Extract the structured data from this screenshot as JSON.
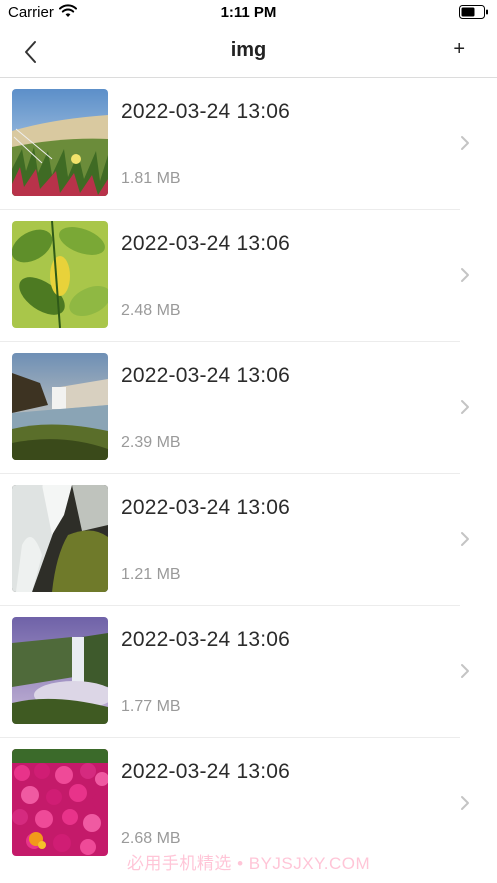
{
  "status_bar": {
    "carrier": "Carrier",
    "time": "1:11 PM"
  },
  "nav": {
    "title": "img",
    "add_label": "+"
  },
  "files": [
    {
      "date": "2022-03-24 13:06",
      "size": "1.81 MB",
      "thumbnail": "dune-flowers"
    },
    {
      "date": "2022-03-24 13:06",
      "size": "2.48 MB",
      "thumbnail": "green-leaves"
    },
    {
      "date": "2022-03-24 13:06",
      "size": "2.39 MB",
      "thumbnail": "waterfall-cliff"
    },
    {
      "date": "2022-03-24 13:06",
      "size": "1.21 MB",
      "thumbnail": "waterfall-mossy"
    },
    {
      "date": "2022-03-24 13:06",
      "size": "1.77 MB",
      "thumbnail": "waterfall-mist"
    },
    {
      "date": "2022-03-24 13:06",
      "size": "2.68 MB",
      "thumbnail": "pink-flowers"
    }
  ],
  "watermark": "必用手机精选 • BYJSJXY.COM",
  "colors": {
    "divider": "#ececec",
    "secondary_text": "#9a9a9a",
    "chevron": "#c4c4c4"
  }
}
